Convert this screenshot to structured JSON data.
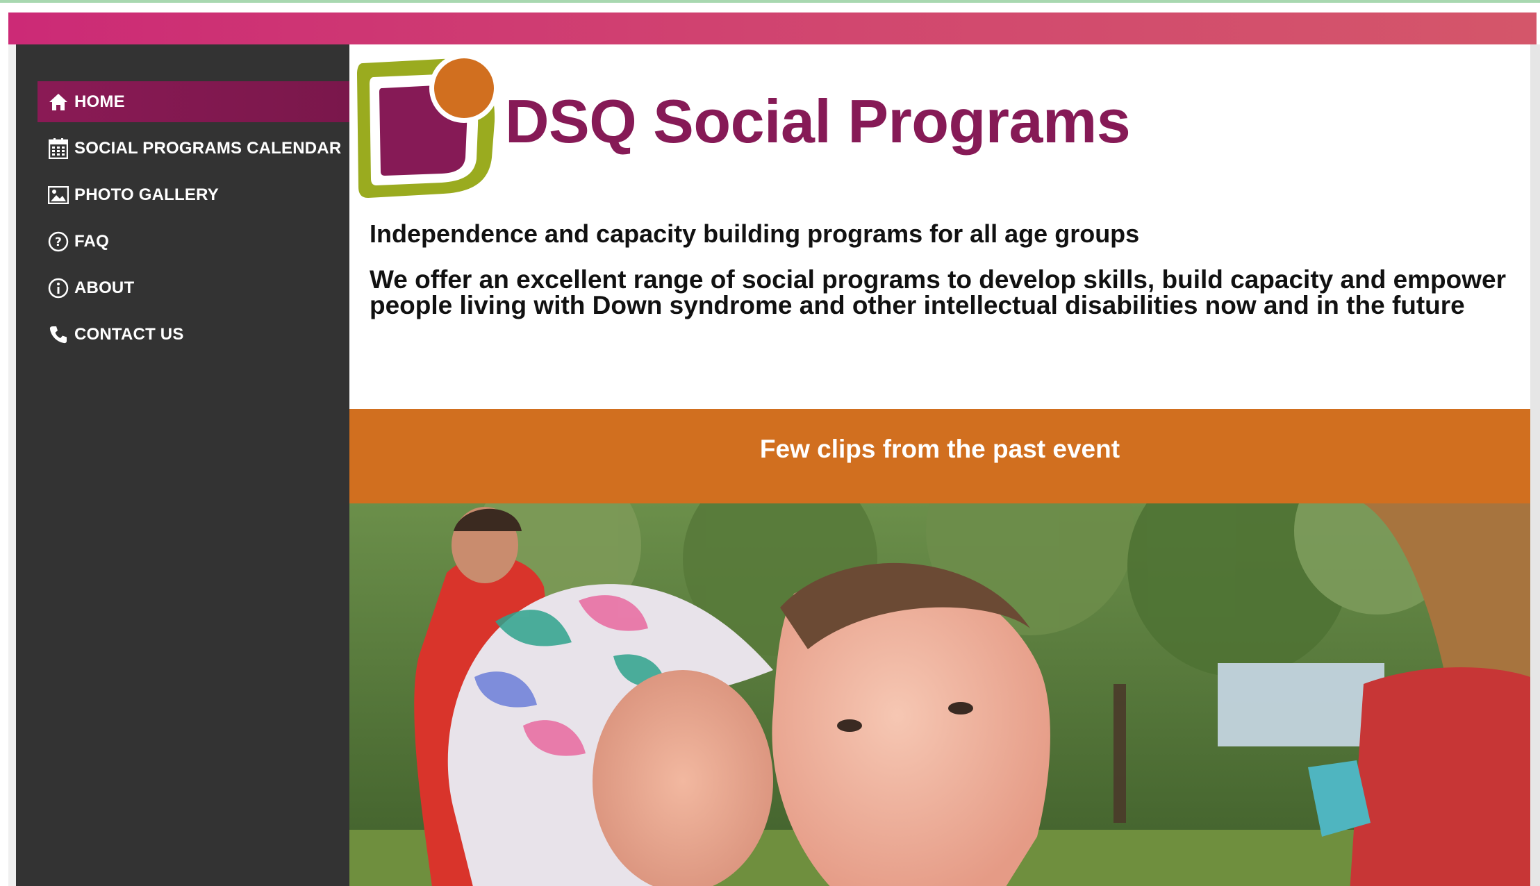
{
  "nav": {
    "items": [
      {
        "label": "HOME",
        "icon": "home-icon",
        "active": true
      },
      {
        "label": "SOCIAL PROGRAMS CALENDAR",
        "icon": "calendar-icon",
        "active": false
      },
      {
        "label": "PHOTO GALLERY",
        "icon": "image-icon",
        "active": false
      },
      {
        "label": "FAQ",
        "icon": "question-circle-icon",
        "active": false
      },
      {
        "label": "ABOUT",
        "icon": "info-circle-icon",
        "active": false
      },
      {
        "label": "CONTACT US",
        "icon": "phone-icon",
        "active": false
      }
    ]
  },
  "header": {
    "title": "DSQ Social Programs"
  },
  "main": {
    "tagline": "Independence and capacity building programs for all age groups",
    "intro": "We offer an excellent range of social programs to develop skills, build capacity and empower people living with Down syndrome and other intellectual disabilities now and in the future",
    "clips_title": "Few clips from the past event"
  },
  "colors": {
    "banner": "#cc2a76",
    "sidebar": "#333333",
    "active_nav": "#861a56",
    "title": "#861a56",
    "clips_bar": "#d16f1f",
    "logo_green": "#9aab1f",
    "logo_orange": "#d16f1f"
  }
}
